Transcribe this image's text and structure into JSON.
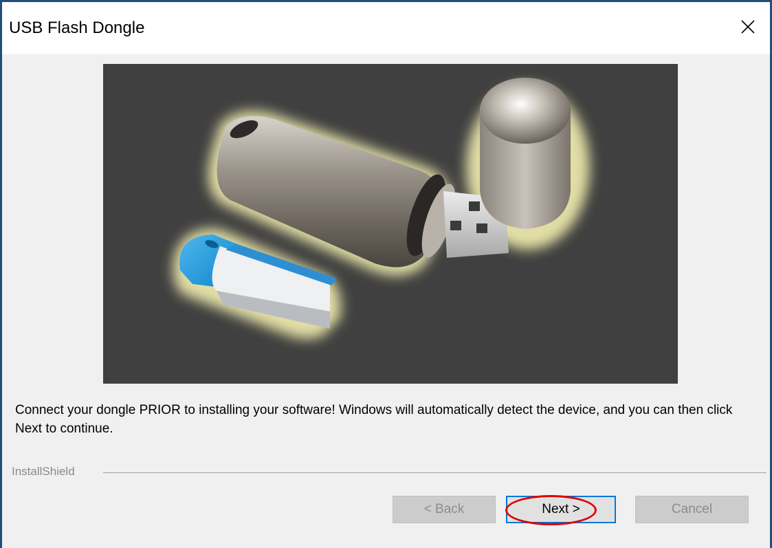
{
  "window": {
    "title": "USB Flash Dongle",
    "close_icon": "close-icon"
  },
  "hero": {
    "alt": "USB flash dongles image",
    "background_color": "#404040"
  },
  "description": "Connect your dongle PRIOR to installing your software!  Windows will automatically detect the device, and you can then click Next to continue.",
  "branding": {
    "label": "InstallShield"
  },
  "buttons": {
    "back": "< Back",
    "next": "Next >",
    "cancel": "Cancel"
  },
  "colors": {
    "window_border": "#1f4e79",
    "focus_border": "#0078d7",
    "annotation": "#e00000"
  }
}
